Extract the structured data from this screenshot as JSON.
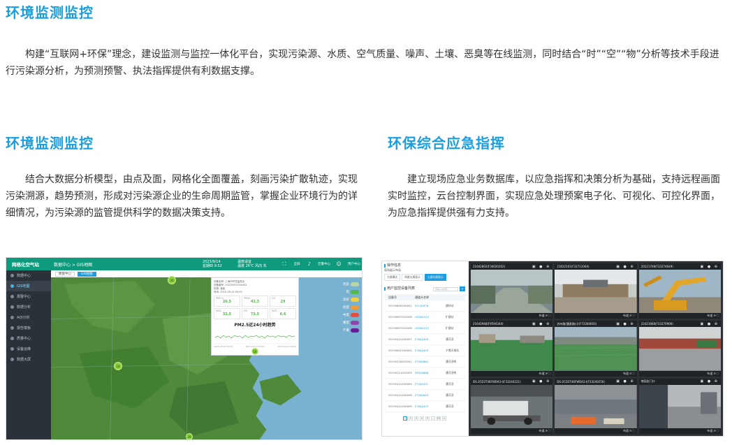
{
  "section_top": {
    "title": "环境监测监控",
    "body": "构建“互联网+环保”理念，建设监测与监控一体化平台，实现污染源、水质、空气质量、噪声、土壤、恶臭等在线监测，同时结合“时”“空”“物”分析等技术手段进行污染源分析，为预测预警、执法指挥提供有利数据支撑。"
  },
  "section_left": {
    "title": "环境监测监控",
    "body": "结合大数据分析模型，由点及面，网格化全面覆盖，刻画污染扩散轨迹，实现污染溯源，趋势预测，形成对污染源企业的生命周期监管，掌握企业环境行为的详细情况，为污染源的监管提供科学的数据决策支持。"
  },
  "section_right": {
    "title": "环保综合应急指挥",
    "body": "建立现场应急业务数据库，以应急指挥和决策分析为基础，支持远程画面实时监控，云台控制界面，实现应急处理预案电子化、可视化、可控化界面，为应急指挥提供强有力支持。"
  },
  "colors": {
    "heading": "#1a9ee0",
    "topbar": "#0e9a7c",
    "sidebar": "#2b3138"
  },
  "dashboard": {
    "logo": "网格化空气站",
    "breadcrumb": "数据中心 > GIS地图",
    "time_line1": "2023/9/14",
    "time_line2": "星期四 9:52",
    "weather_line1": "温度适宜",
    "weather_line2": "温度 26℃ 风向 东",
    "header_icons": [
      "全屏",
      "告警中心",
      "用户中心"
    ],
    "sidebar": [
      {
        "label": "数据中心",
        "active": false
      },
      {
        "label": "GIS地图",
        "active": true
      },
      {
        "label": "报警中心",
        "active": false
      },
      {
        "label": "数据分析",
        "active": false
      },
      {
        "label": "AQI分析",
        "active": false
      },
      {
        "label": "报告模板",
        "active": false
      },
      {
        "label": "质量中心",
        "active": false
      },
      {
        "label": "设备运维",
        "active": false
      },
      {
        "label": "数据大屏",
        "active": false
      }
    ],
    "tabs": [
      {
        "label": "数据中心",
        "active": false
      },
      {
        "label": "GIS地图",
        "active": true
      }
    ],
    "legend": [
      {
        "label": "优良",
        "color": "#b7d6a6"
      },
      {
        "label": "优",
        "color": "#52b94a"
      },
      {
        "label": "良好",
        "color": "#f4d03f"
      },
      {
        "label": "轻度",
        "color": "#f29b38"
      },
      {
        "label": "中度",
        "color": "#e74c3c"
      },
      {
        "label": "重度",
        "color": "#8e44ad"
      },
      {
        "label": "严重",
        "color": "#6a1b9a"
      }
    ],
    "popup": {
      "lines": [
        "设备名称: 上海市环境监测点",
        "设备编号: 20220910154402",
        "所属: 省级",
        "时间: 2023-09-14 09:52"
      ],
      "cells": [
        {
          "key": "PM2.5",
          "value": "26.5"
        },
        {
          "key": "PM10",
          "value": "42.3"
        },
        {
          "key": "CO",
          "value": "29"
        },
        {
          "key": "NO2",
          "value": "32.5"
        },
        {
          "key": "O3",
          "value": "73.5"
        },
        {
          "key": "SO2",
          "value": "6.6"
        }
      ],
      "chart_title": "PM2.5近24小时趋势",
      "axis_labels": [
        "2023-09-13 09:00",
        "2023-09-13 18:00",
        "2023-09-14 09:00"
      ]
    },
    "markers": [
      "20",
      "18",
      "16",
      "29"
    ]
  },
  "emergency": {
    "panel_title": "操作信息",
    "panel_sub": "现场展示布局",
    "tabs": [
      {
        "label": "大屏模式",
        "active": false
      },
      {
        "label": "四屏分屏显示",
        "active": false
      },
      {
        "label": "九屏分屏显示",
        "active": true
      }
    ],
    "list_title": "用户监控设备列表",
    "search_placeholder": "请输入关键字",
    "columns": [
      "设备号",
      "通道头名称",
      ""
    ],
    "rows": [
      [
        "20230609100001",
        "F0132978",
        "建材站"
      ],
      [
        "20230607010006",
        "G0564313",
        "扩建站"
      ],
      [
        "20230607010006",
        "G0564313",
        "扩建站"
      ],
      [
        "20230110100007",
        "F7851409",
        "漕河泾"
      ],
      [
        "20230610100002",
        "F7851403",
        "宁港天地站"
      ],
      [
        "20230118010001",
        "F7284682",
        "漕河泾南"
      ],
      [
        "20230121010003",
        "F6528686",
        "漕河泾南"
      ],
      [
        "20230110100004",
        "F7284421",
        "漕河泾"
      ],
      [
        "20230110100008",
        "F7284649",
        "漕河泾"
      ],
      [
        "20230110100009",
        "F7851425",
        "漕河泾"
      ]
    ],
    "pages": [
      "1",
      "2",
      "3",
      "4",
      "5",
      "...",
      "15",
      ">"
    ],
    "cameras": [
      {
        "title": "21642802(F34020202)",
        "scene": "corridor"
      },
      {
        "title": "21622101(F32711064)",
        "scene": "site"
      },
      {
        "title": "20121708(F33274649)",
        "scene": "crane"
      },
      {
        "title": "21642948(F9594344)",
        "scene": "green"
      },
      {
        "title": "苏州路(漕麦路口)(F72284603)",
        "scene": "net"
      },
      {
        "title": "22421668(F33270906)",
        "scene": "road"
      },
      {
        "title": "DS-2CD3T46FWDA3-I(F33240221)",
        "scene": "truck"
      },
      {
        "title": "DS-2CD3T46FWDA3-I(F33240250)",
        "scene": "hall"
      },
      {
        "title": "南园出门口",
        "scene": "gate"
      }
    ],
    "cam_icons": "▣ ● ⊕",
    "cam_foot": "布道 ⟳ ⛶"
  }
}
